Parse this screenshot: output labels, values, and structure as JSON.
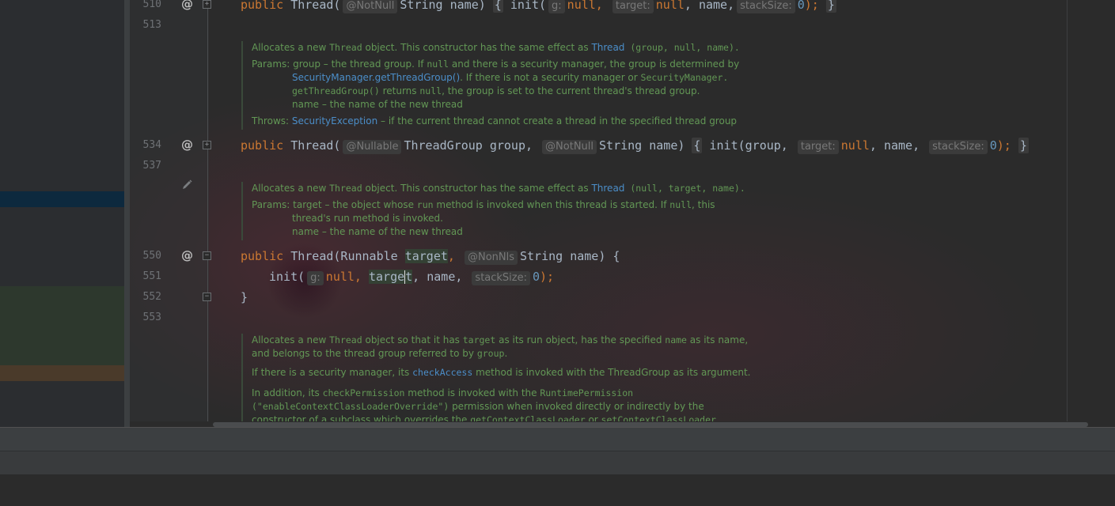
{
  "line_numbers": [
    "510",
    "513",
    "534",
    "537",
    "550",
    "551",
    "552",
    "553"
  ],
  "gutter": {
    "override_marker": "@"
  },
  "code": {
    "l510": {
      "kw_public": "public",
      "name": "Thread",
      "open": "(",
      "hint_ann": "@NotNull",
      "param": "String name",
      "close": ")",
      "brace_open": "{",
      "init": "init(",
      "hint_g": "g:",
      "null1": "null",
      "comma1": ",",
      "hint_target": "target:",
      "null2": "null",
      "name_arg": ", name,",
      "hint_stack": "stackSize:",
      "zero": "0",
      "tail": ");",
      "brace_close": "}"
    },
    "l534": {
      "kw_public": "public",
      "name": "Thread",
      "open": "(",
      "hint_ann1": "@Nullable",
      "param1": "ThreadGroup group,",
      "hint_ann2": "@NotNull",
      "param2": "String name)",
      "brace_open": "{",
      "init": "init(group,",
      "hint_target": "target:",
      "null1": "null",
      "name_arg": ", name,",
      "hint_stack": "stackSize:",
      "zero": "0",
      "tail": ");",
      "brace_close": "}"
    },
    "l550": {
      "kw_public": "public",
      "name": "Thread",
      "open": "(Runnable ",
      "target": "target",
      "comma": ",",
      "hint_ann": "@NonNls",
      "param": "String name) {"
    },
    "l551": {
      "init": "init(",
      "hint_g": "g:",
      "null1": "null",
      "comma1": ",",
      "target_a": "targe",
      "target_b": "t",
      "name_arg": ", name,",
      "hint_stack": "stackSize:",
      "zero": "0",
      "tail": ");"
    },
    "l552": {
      "brace": "}"
    }
  },
  "docs": {
    "d1": {
      "l1_a": "Allocates a new ",
      "l1_code": "Thread",
      "l1_b": " object. This constructor has the same effect as ",
      "l1_link": "Thread",
      "l1_c": " (group, null, name).",
      "params_label": "Params: ",
      "p1_a": "group – the thread group. If ",
      "p1_null": "null",
      "p1_b": " and there is a security manager, the group is determined by",
      "p2_link": "SecurityManager.getThreadGroup()",
      "p2_a": ". If there is not a security manager or ",
      "p2_code": "SecurityManager.",
      "p3_code": "getThreadGroup()",
      "p3_a": " returns ",
      "p3_null": "null",
      "p3_b": ", the group is set to the current thread's thread group.",
      "p4": "name – the name of the new thread",
      "throws_label": "Throws: ",
      "t_link": "SecurityException",
      "t_a": " – if the current thread cannot create a thread in the specified thread group"
    },
    "d2": {
      "l1_a": "Allocates a new ",
      "l1_code": "Thread",
      "l1_b": " object. This constructor has the same effect as ",
      "l1_link": "Thread",
      "l1_c": " (null, target, name).",
      "params_label": "Params: ",
      "p1_a": "target – the object whose ",
      "p1_code": "run",
      "p1_b": " method is invoked when this thread is started. If ",
      "p1_null": "null",
      "p1_c": ", this",
      "p2": "thread's run method is invoked.",
      "p3": "name – the name of the new thread"
    },
    "d3": {
      "l1_a": "Allocates a new ",
      "l1_code": "Thread",
      "l1_b": " object so that it has ",
      "l1_code2": "target",
      "l1_c": " as its run object, has the specified ",
      "l1_code3": "name",
      "l1_d": " as its name,",
      "l2_a": "and belongs to the thread group referred to by ",
      "l2_code": "group",
      "l2_b": ".",
      "l3_a": "If there is a security manager, its ",
      "l3_link": "checkAccess",
      "l3_b": " method is invoked with the ThreadGroup as its argument.",
      "l4_a": "In addition, its ",
      "l4_code": "checkPermission",
      "l4_b": " method is invoked with the ",
      "l4_code2": "RuntimePermission",
      "l5_code": "(\"enableContextClassLoaderOverride\")",
      "l5_a": " permission when invoked directly or indirectly by the",
      "l6_a": "constructor of a subclass which overrides the ",
      "l6_code": "getContextClassLoader",
      "l6_b": " or ",
      "l6_code2": "setContextClassLoader"
    }
  },
  "colors": {
    "keyword": "#cc7832",
    "doc_text": "#629755",
    "doc_link": "#4b8ec9",
    "number": "#6897bb",
    "background": "#2b2b2b"
  }
}
